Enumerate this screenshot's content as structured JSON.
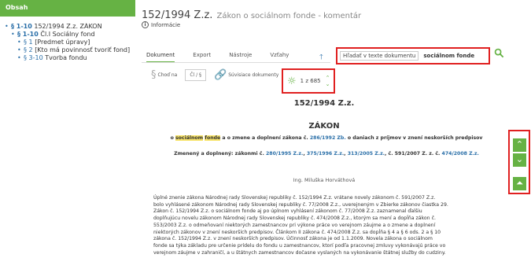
{
  "sidebar": {
    "title": "Obsah",
    "items": [
      {
        "num": "§ 1-10",
        "text": "152/1994 Z.z. ZÁKON"
      },
      {
        "num": "§ 1-10",
        "text": "Čl.I Sociálny fond"
      },
      {
        "num": "§ 1",
        "text": "[Predmet úpravy]"
      },
      {
        "num": "§ 2",
        "text": "[Kto má povinnosť tvoriť fond]"
      },
      {
        "num": "§ 3-10",
        "text": "Tvorba fondu"
      }
    ]
  },
  "header": {
    "doc_number": "152/1994 Z.z.",
    "doc_name": "Zákon o sociálnom fonde - komentár",
    "info_label": "Informácie"
  },
  "tabs": [
    "Dokument",
    "Export",
    "Nástroje",
    "Vzťahy"
  ],
  "search": {
    "label": "Hľadať v texte dokumentu",
    "value": "sociálnom fonde"
  },
  "toolbar": {
    "goto_label": "Choď na",
    "page_value": "Čl / §",
    "related_label": "Súvisiace dokumenty",
    "highlight_count": "1 z 685"
  },
  "document": {
    "title": "152/1994 Z.z.",
    "heading": "ZÁKON",
    "sub_pre": "o",
    "sub_hl1": "sociálnom",
    "sub_hl2": "fonde",
    "sub_mid": "a o zmene a doplnení zákona č.",
    "sub_link": "286/1992 Zb.",
    "sub_post": "o daniach z príjmov v znení neskorších predpisov",
    "amended_pre": "Zmenený a doplnený: zákonmi č.",
    "amended_links": [
      "280/1995 Z.z.",
      "375/1996 Z.z.",
      "313/2005 Z.z."
    ],
    "amended_mid": ", č. 591/2007 Z. z. č.",
    "amended_last": "474/2008 Z.z.",
    "author": "Ing. Miluška Horváthová",
    "paragraph_lines": [
      "Úplné znenie zákona Národnej rady Slovenskej republiky č. 152/1994 Z.z. vrátane novely zákonom č. 591/2007 Z.z.",
      "bolo vyhlásené zákonom Národnej rady Slovenskej republiky č. 77/2008 Z.z., uverejneným v Zbierke zákonov čiastka 29.",
      "Zákon č. 152/1994 Z.z. o sociálnom fonde aj po úplnom vyhlásení zákonom č. 77/2008 Z.z. zaznamenal ďalšiu",
      "doplňujúcu novelu zákonom Národnej rady Slovenskej republiky č. 474/2008 Z.z., ktorým sa mení a dopĺňa zákon č.",
      "553/2003 Z.z. o odmeňovaní niektorých zamestnancov pri výkone práce vo verejnom záujme a o zmene a doplnení",
      "niektorých zákonov v znení neskorších predpisov. Článkom II zákona č. 474/2008 Z.z. sa dopĺňa § 4 a § 6 ods. 2 a § 10",
      "zákona č. 152/1994 Z.z. v znení neskorších predpisov. Účinnosť zákona je od 1.1.2009. Novela zákona o sociálnom",
      "fonde sa týka základu pre určenie prídelu do fondu u zamestnancov, ktorí podľa pracovnej zmluvy vykonávajú práce vo",
      "verejnom záujme v zahraničí, a u štátnych zamestnancov dočasne vyslaných na vykonávanie štátnej služby do cudziny."
    ]
  },
  "colors": {
    "accent": "#66b244",
    "highlight": "#f7e36a",
    "link": "#2a6fa8",
    "callout": "#e02020"
  }
}
